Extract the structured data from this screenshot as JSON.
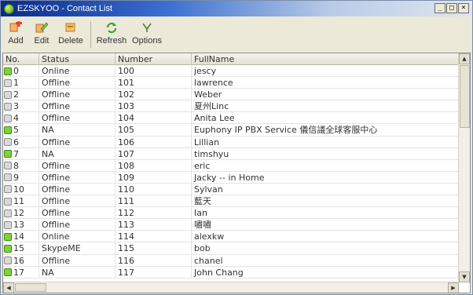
{
  "window": {
    "title": "EZSKYOO - Contact List"
  },
  "title_buttons": {
    "minimize": "_",
    "maximize": "□",
    "close": "×"
  },
  "toolbar": {
    "add_label": "Add",
    "edit_label": "Edit",
    "delete_label": "Delete",
    "refresh_label": "Refresh",
    "options_label": "Options"
  },
  "columns": {
    "no": "No.",
    "status": "Status",
    "number": "Number",
    "name": "FullName"
  },
  "rows": [
    {
      "no": "0",
      "status": "Online",
      "number": "100",
      "name": "jescy",
      "online": true
    },
    {
      "no": "1",
      "status": "Offline",
      "number": "101",
      "name": "lawrence",
      "online": false
    },
    {
      "no": "2",
      "status": "Offline",
      "number": "102",
      "name": "Weber",
      "online": false
    },
    {
      "no": "3",
      "status": "Offline",
      "number": "103",
      "name": "夏州Linc",
      "online": false
    },
    {
      "no": "4",
      "status": "Offline",
      "number": "104",
      "name": "Anita Lee",
      "online": false
    },
    {
      "no": "5",
      "status": "NA",
      "number": "105",
      "name": "Euphony IP PBX Service 儀信議全球客服中心",
      "online": true
    },
    {
      "no": "6",
      "status": "Offline",
      "number": "106",
      "name": "Lillian",
      "online": false
    },
    {
      "no": "7",
      "status": "NA",
      "number": "107",
      "name": "timshyu",
      "online": true
    },
    {
      "no": "8",
      "status": "Offline",
      "number": "108",
      "name": "eric",
      "online": false
    },
    {
      "no": "9",
      "status": "Offline",
      "number": "109",
      "name": "Jacky -- in Home",
      "online": false
    },
    {
      "no": "10",
      "status": "Offline",
      "number": "110",
      "name": "Sylvan",
      "online": false
    },
    {
      "no": "11",
      "status": "Offline",
      "number": "111",
      "name": "藍天",
      "online": false
    },
    {
      "no": "12",
      "status": "Offline",
      "number": "112",
      "name": "Ian",
      "online": false
    },
    {
      "no": "13",
      "status": "Offline",
      "number": "113",
      "name": "嘯嘯",
      "online": false
    },
    {
      "no": "14",
      "status": "Online",
      "number": "114",
      "name": "alexkw",
      "online": true
    },
    {
      "no": "15",
      "status": "SkypeME",
      "number": "115",
      "name": "bob",
      "online": true
    },
    {
      "no": "16",
      "status": "Offline",
      "number": "116",
      "name": "chanel",
      "online": false
    },
    {
      "no": "17",
      "status": "NA",
      "number": "117",
      "name": "John Chang",
      "online": true
    }
  ],
  "icons": {
    "add": "add-contact-icon",
    "edit": "edit-contact-icon",
    "delete": "delete-contact-icon",
    "refresh": "refresh-icon",
    "options": "options-icon"
  },
  "colors": {
    "online": "#7fd23a",
    "offline": "#d9d9d9",
    "titlebar": "#0a2a8a"
  }
}
